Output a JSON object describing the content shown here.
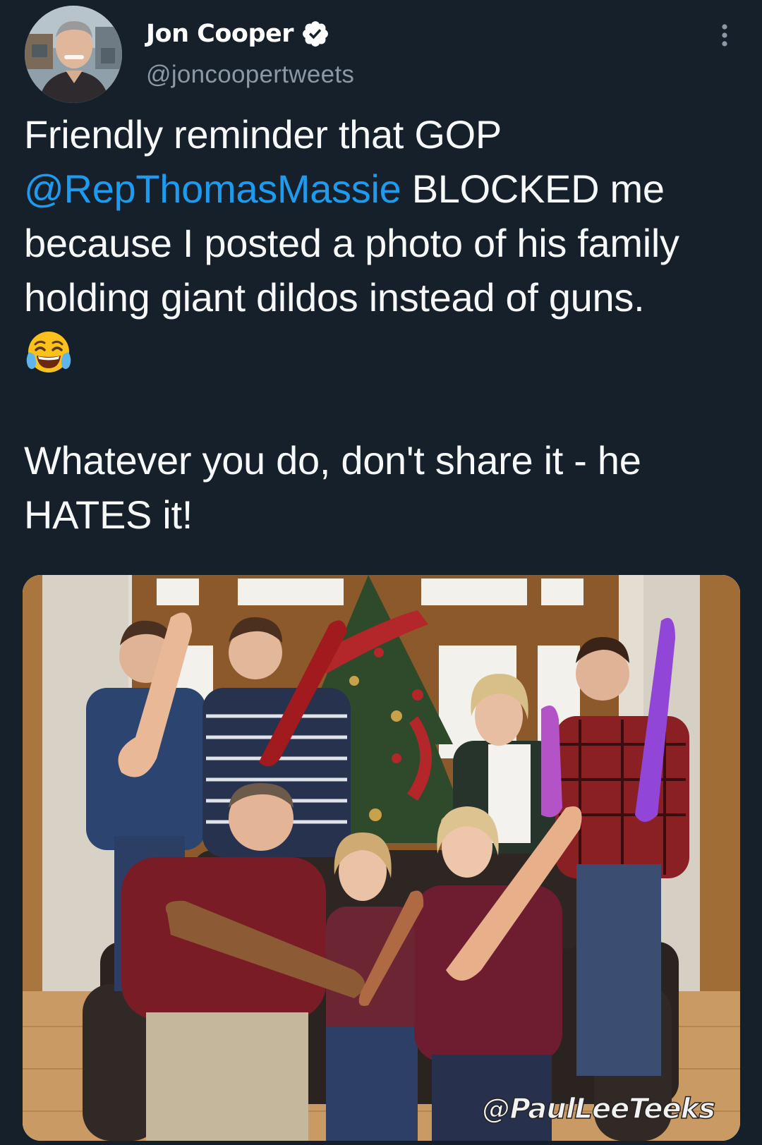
{
  "author": {
    "display_name": "Jon Cooper",
    "handle": "@joncoopertweets",
    "verified": true,
    "avatar_icon": "profile-photo"
  },
  "menu_icon": "more-options-icon",
  "tweet": {
    "line1": "Friendly reminder that GOP",
    "mention": "@RepThomasMassie",
    "line2_rest": " BLOCKED me",
    "line3": "because I posted a photo of his family",
    "line4": "holding giant dildos instead of guns.",
    "emoji": "face-with-tears-of-joy",
    "line5": "Whatever you do, don't share it - he",
    "line6": "HATES it!"
  },
  "media": {
    "type": "photo",
    "watermark": "@PaulLeeTeeks"
  },
  "colors": {
    "background": "#15202b",
    "text": "#f7f9f9",
    "secondary_text": "#8b98a5",
    "link": "#1d9bf0",
    "verified_badge": "#ffffff"
  }
}
